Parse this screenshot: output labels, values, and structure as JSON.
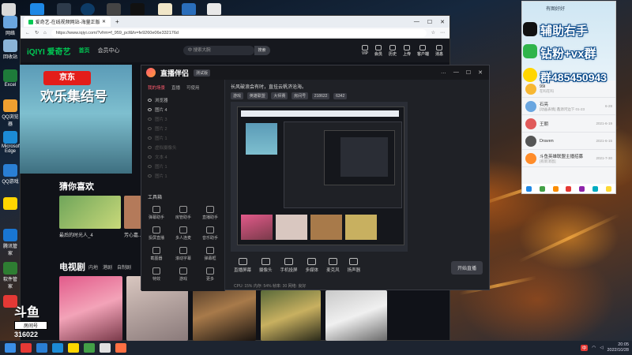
{
  "browser": {
    "tab_title": "爱奇艺-在线视频网站-海量正版高...",
    "url": "https://www.iqiyi.com/?vfrm=f_959_pcf&fv=fe9260e06e332176d",
    "win_buttons": [
      "—",
      "☐",
      "✕"
    ]
  },
  "iqiyi": {
    "logo": "iQIYI 爱奇艺",
    "nav": [
      "首页",
      "会员中心"
    ],
    "search_placeholder": "中 搜索大腕",
    "search_btn": "搜索",
    "top_icons": [
      "VIP",
      "会员",
      "历史",
      "上传",
      "客户端",
      "消息"
    ],
    "banner_brand": "京东",
    "banner_title": "欢乐集结号",
    "section_guess": "猜你喜欢",
    "guess_captions": [
      "最后的时光人_4",
      "芳心嘉..."
    ],
    "section_tv": "电视剧",
    "tv_tabs": [
      "内地",
      "港剧",
      "自制剧"
    ]
  },
  "studio": {
    "title": "直播伴侣",
    "badge": "测试版",
    "win_buttons": [
      "…",
      "—",
      "☐",
      "✕"
    ],
    "tabs": [
      "我的场景",
      "直播",
      "可使用"
    ],
    "scenes": [
      {
        "label": "浏览器",
        "dim": false
      },
      {
        "label": "图片 4",
        "dim": false
      },
      {
        "label": "图片 3",
        "dim": true
      },
      {
        "label": "图片 2",
        "dim": true
      },
      {
        "label": "图片 1",
        "dim": true
      },
      {
        "label": "虚拟摄像头",
        "dim": true
      },
      {
        "label": "文本 4",
        "dim": true
      },
      {
        "label": "图片 1",
        "dim": true
      },
      {
        "label": "图片 1",
        "dim": true
      }
    ],
    "tools_title": "工具箱",
    "tools": [
      "弹幕助手",
      "房管助手",
      "直播助手",
      "投屏直播",
      "多人连麦",
      "音乐助手",
      "截图器",
      "滚动字幕",
      "弹幕框",
      "特效",
      "游戏",
      "更多"
    ],
    "topbar_text": "长风破浪会有时，直挂云帆济沧海。",
    "topbar_tags": [
      "游戏",
      "英雄联盟",
      "大师赛",
      "房间号",
      "218622",
      "6342"
    ],
    "bottom_buttons": [
      "直播屏幕",
      "摄像头",
      "手机投屏",
      "多媒体",
      "麦克风",
      "扬声器"
    ],
    "start_label": "开始直播",
    "status": "CPU: 15%  内存: 54%  帧率: 30  网络: 良好"
  },
  "overlay": {
    "line1": "辅助右手",
    "line2": "钻粉+vx群",
    "line3": "群485450943",
    "header_small": "有图好好"
  },
  "qq": {
    "rows": [
      {
        "name": "99i",
        "sub": "在吗在吗",
        "date": "",
        "color": "#f7b733"
      },
      {
        "name": "石亮",
        "sub": "[动画表情] 鑫源河边下 01-23",
        "date": "6-28",
        "color": "#6aa6e0"
      },
      {
        "name": "王朝",
        "sub": "",
        "date": "2021-6-19",
        "color": "#e05a5a"
      },
      {
        "name": "Draven",
        "sub": "",
        "date": "2021-6-15",
        "color": "#555"
      },
      {
        "name": "斗鱼英雄联盟主播招募",
        "sub": "[有新消息]",
        "date": "2021-7-30",
        "color": "#ff8c2a"
      }
    ]
  },
  "douyu": {
    "logo": "斗鱼",
    "room_label": "房间号",
    "room_id": "316022"
  },
  "taskbar": {
    "time": "20:05",
    "date": "2022/10/28",
    "lang": "中"
  },
  "desktop_icons": [
    "网络",
    "",
    "回收站",
    "",
    "Excel",
    "",
    "QQ浏览器",
    "Microsoft Edge",
    "QQ游戏",
    "",
    "腾讯管家",
    "",
    "软件管家",
    ""
  ],
  "colors": {
    "iqiyi_green": "#00c853",
    "studio_accent": "#ff5b6e",
    "overlay_stroke": "#0a4a8a"
  }
}
